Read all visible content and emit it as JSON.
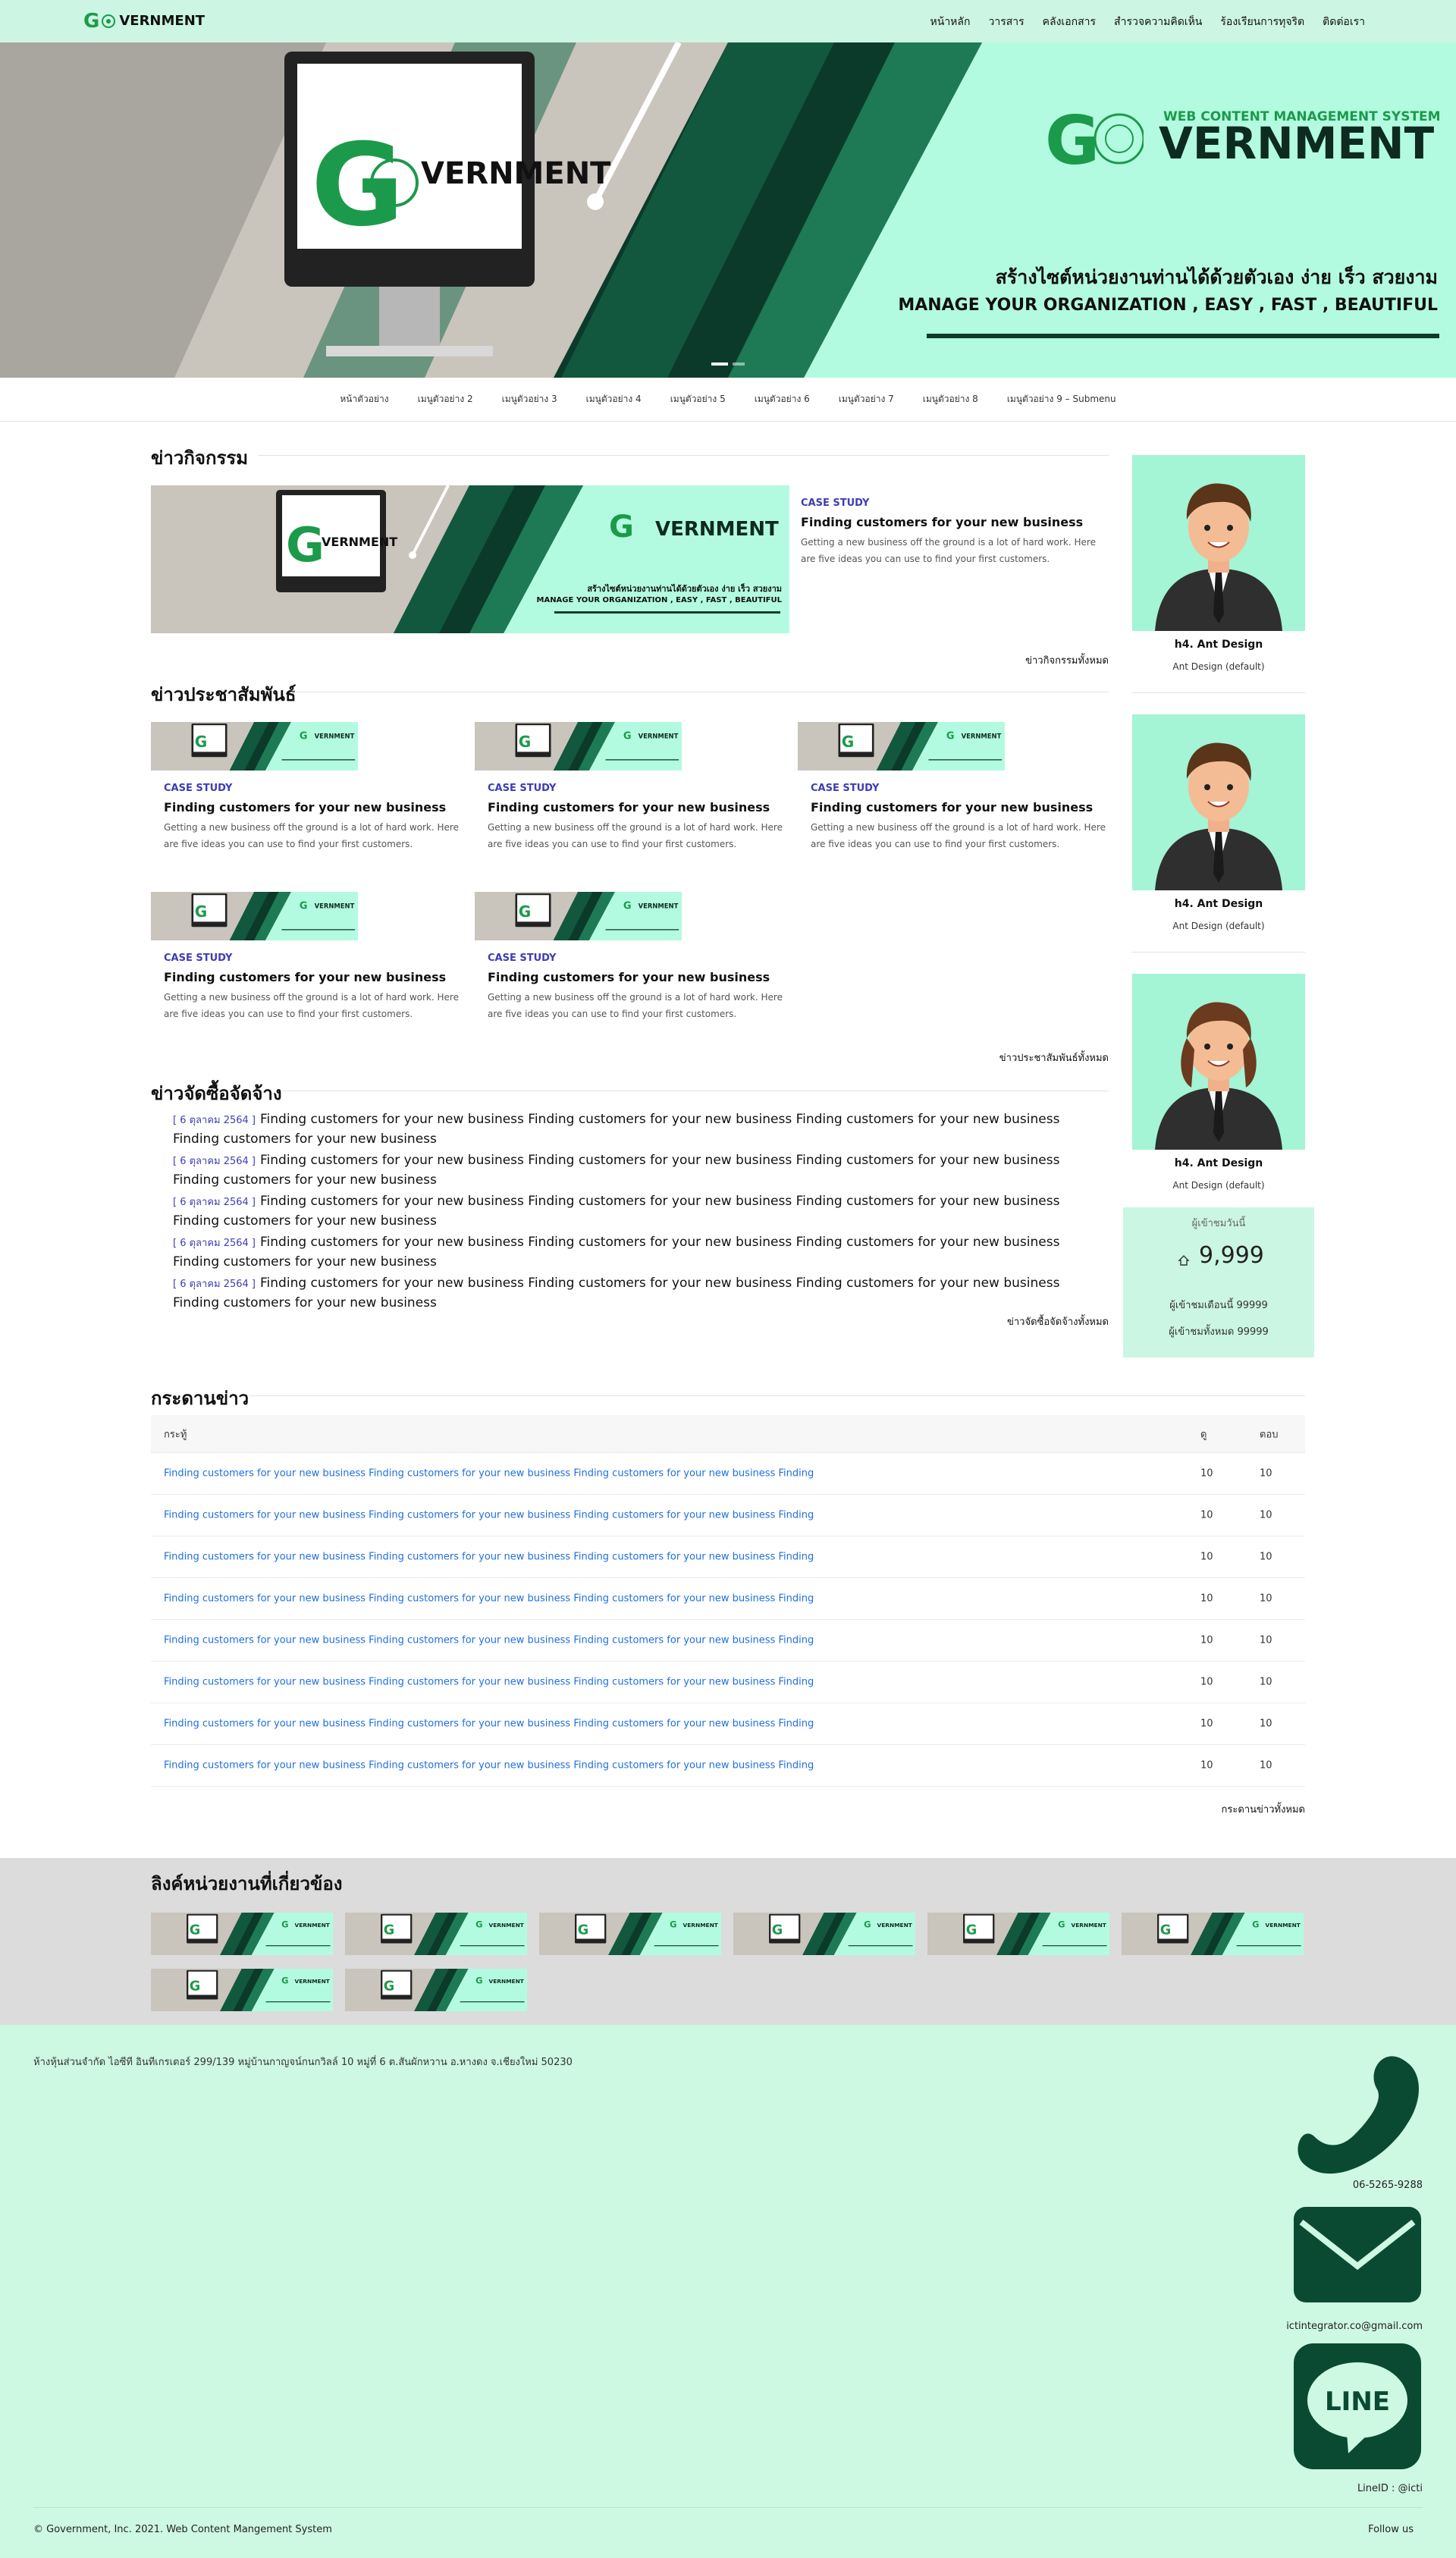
{
  "header": {
    "logo_text": "VERNMENT",
    "nav": [
      "หน้าหลัก",
      "วารสาร",
      "คลังเอกสาร",
      "สำรวจความคิดเห็น",
      "ร้องเรียนการทุจริต",
      "ติดต่อเรา"
    ]
  },
  "hero": {
    "logo_sub": "WEB CONTENT MANAGEMENT SYSTEM",
    "logo_word": "VERNMENT",
    "monitor_word": "VERNMENT",
    "tagline_th": "สร้างไซต์หน่วยงานท่านได้ด้วยตัวเอง ง่าย เร็ว สวยงาม",
    "tagline_en": "MANAGE YOUR ORGANIZATION , EASY , FAST , BEAUTIFUL"
  },
  "subnav": [
    "หน้าตัวอย่าง",
    "เมนูตัวอย่าง 2",
    "เมนูตัวอย่าง 3",
    "เมนูตัวอย่าง 4",
    "เมนูตัวอย่าง 5",
    "เมนูตัวอย่าง 6",
    "เมนูตัวอย่าง 7",
    "เมนูตัวอย่าง 8",
    "เมนูตัวอย่าง 9 – Submenu"
  ],
  "activities": {
    "title": "ข่าวกิจกรรม",
    "case": "CASE STUDY",
    "heading": "Finding customers for your new business",
    "body": "Getting a new business off the ground is a lot of hard work. Here are five ideas you can use to find your first customers.",
    "more": "ข่าวกิจกรรมทั้งหมด"
  },
  "pr": {
    "title": "ข่าวประชาสัมพันธ์",
    "cards": [
      {
        "case": "CASE STUDY",
        "heading": "Finding customers for your new business",
        "body": "Getting a new business off the ground is a lot of hard work. Here are five ideas you can use to find your first customers."
      },
      {
        "case": "CASE STUDY",
        "heading": "Finding customers for your new business",
        "body": "Getting a new business off the ground is a lot of hard work. Here are five ideas you can use to find your first customers."
      },
      {
        "case": "CASE STUDY",
        "heading": "Finding customers for your new business",
        "body": "Getting a new business off the ground is a lot of hard work. Here are five ideas you can use to find your first customers."
      },
      {
        "case": "CASE STUDY",
        "heading": "Finding customers for your new business",
        "body": "Getting a new business off the ground is a lot of hard work. Here are five ideas you can use to find your first customers."
      },
      {
        "case": "CASE STUDY",
        "heading": "Finding customers for your new business",
        "body": "Getting a new business off the ground is a lot of hard work. Here are five ideas you can use to find your first customers."
      }
    ],
    "more": "ข่าวประชาสัมพันธ์ทั้งหมด"
  },
  "procurement": {
    "title": "ข่าวจัดซื้อจัดจ้าง",
    "items": [
      {
        "date": "[ 6 ตุลาคม 2564 ]",
        "text": "Finding customers for your new business Finding customers for your new business Finding customers for your new business Finding customers for your new business"
      },
      {
        "date": "[ 6 ตุลาคม 2564 ]",
        "text": "Finding customers for your new business Finding customers for your new business Finding customers for your new business Finding customers for your new business"
      },
      {
        "date": "[ 6 ตุลาคม 2564 ]",
        "text": "Finding customers for your new business Finding customers for your new business Finding customers for your new business Finding customers for your new business"
      },
      {
        "date": "[ 6 ตุลาคม 2564 ]",
        "text": "Finding customers for your new business Finding customers for your new business Finding customers for your new business Finding customers for your new business"
      },
      {
        "date": "[ 6 ตุลาคม 2564 ]",
        "text": "Finding customers for your new business Finding customers for your new business Finding customers for your new business Finding customers for your new business"
      }
    ],
    "more": "ข่าวจัดซื้อจัดจ้างทั้งหมด"
  },
  "sidebar": {
    "people": [
      {
        "name": "h4. Ant Design",
        "sub": "Ant Design (default)"
      },
      {
        "name": "h4. Ant Design",
        "sub": "Ant Design (default)"
      },
      {
        "name": "h4. Ant Design",
        "sub": "Ant Design (default)"
      }
    ],
    "stats": {
      "today_label": "ผู้เข้าชมวันนี้",
      "today_value": "9,999",
      "month": "ผู้เข้าชมเดือนนี้ 99999",
      "total": "ผู้เข้าชมทั้งหมด 99999"
    }
  },
  "board": {
    "title": "กระดานข่าว",
    "headers": [
      "กระทู้",
      "ดู",
      "ตอบ"
    ],
    "rows": [
      {
        "topic": "Finding customers for your new business Finding customers for your new business Finding customers for your new business Finding",
        "views": "10",
        "replies": "10"
      },
      {
        "topic": "Finding customers for your new business Finding customers for your new business Finding customers for your new business Finding",
        "views": "10",
        "replies": "10"
      },
      {
        "topic": "Finding customers for your new business Finding customers for your new business Finding customers for your new business Finding",
        "views": "10",
        "replies": "10"
      },
      {
        "topic": "Finding customers for your new business Finding customers for your new business Finding customers for your new business Finding",
        "views": "10",
        "replies": "10"
      },
      {
        "topic": "Finding customers for your new business Finding customers for your new business Finding customers for your new business Finding",
        "views": "10",
        "replies": "10"
      },
      {
        "topic": "Finding customers for your new business Finding customers for your new business Finding customers for your new business Finding",
        "views": "10",
        "replies": "10"
      },
      {
        "topic": "Finding customers for your new business Finding customers for your new business Finding customers for your new business Finding",
        "views": "10",
        "replies": "10"
      },
      {
        "topic": "Finding customers for your new business Finding customers for your new business Finding customers for your new business Finding",
        "views": "10",
        "replies": "10"
      }
    ],
    "more": "กระดานข่าวทั้งหมด"
  },
  "links": {
    "title": "ลิงค์หน่วยงานที่เกี่ยวข้อง",
    "count": 8
  },
  "footer": {
    "address": "ห้างหุ้นส่วนจำกัด ไอซีที อินทีเกรเตอร์ 299/139 หมู่บ้านกาญจน์กนกวิลล์ 10 หมู่ที่ 6 ต.สันผักหวาน อ.หางดง จ.เชียงใหม่ 50230",
    "phone": "06-5265-9288",
    "email": "ictintegrator.co@gmail.com",
    "line_icon_text": "LINE",
    "line": "LineID : @icti",
    "copyright": "© Government, Inc. 2021. Web Content Mangement System",
    "follow": "Follow us"
  },
  "colors": {
    "mint": "#b3fbe0",
    "dark_green": "#0a4a33",
    "accent_blue": "#3d3db5",
    "link_blue": "#1f6fe0"
  }
}
